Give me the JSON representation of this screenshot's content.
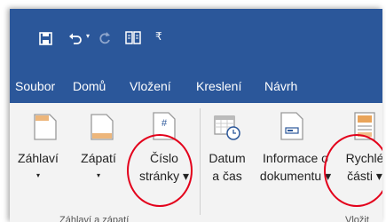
{
  "tabs": [
    "Soubor",
    "Domů",
    "Vložení",
    "Kreslení",
    "Návrh"
  ],
  "buttons": {
    "header": {
      "line1": "Záhlaví",
      "line2": "▾"
    },
    "footer": {
      "line1": "Zápatí",
      "line2": "▾"
    },
    "page_number": {
      "line1": "Číslo",
      "line2": "stránky ▾"
    },
    "date_time": {
      "line1": "Datum",
      "line2": "a čas"
    },
    "doc_info": {
      "line1": "Informace o",
      "line2": "dokumentu ▾"
    },
    "quick_parts": {
      "line1": "Rychlé",
      "line2": "části ▾"
    }
  },
  "groups": {
    "header_footer": "Záhlaví a zápatí",
    "text": "Vložit"
  },
  "colors": {
    "ribbon_blue": "#2b579a",
    "highlight": "#e3001b"
  }
}
